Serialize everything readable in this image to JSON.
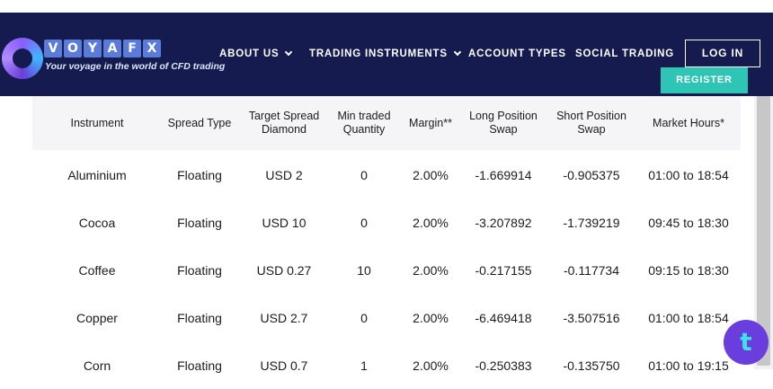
{
  "brand": {
    "logo_letters": [
      "V",
      "O",
      "Y",
      "A",
      "F",
      "X"
    ],
    "tagline": "Your voyage in the world of CFD trading"
  },
  "nav": {
    "items": [
      {
        "label": "ABOUT US",
        "has_dropdown": true
      },
      {
        "label": "TRADING INSTRUMENTS",
        "has_dropdown": true
      },
      {
        "label": "ACCOUNT TYPES",
        "has_dropdown": false
      },
      {
        "label": "SOCIAL TRADING",
        "has_dropdown": false
      }
    ],
    "login_label": "LOG IN",
    "register_label": "REGISTER"
  },
  "table": {
    "headers": [
      "Instrument",
      "Spread Type",
      "Target Spread\nDiamond",
      "Min traded\nQuantity",
      "Margin**",
      "Long Position\nSwap",
      "Short Position\nSwap",
      "Market Hours*"
    ],
    "rows": [
      [
        "Aluminium",
        "Floating",
        "USD 2",
        "0",
        "2.00%",
        "-1.669914",
        "-0.905375",
        "01:00 to 18:54"
      ],
      [
        "Cocoa",
        "Floating",
        "USD 10",
        "0",
        "2.00%",
        "-3.207892",
        "-1.739219",
        "09:45 to 18:30"
      ],
      [
        "Coffee",
        "Floating",
        "USD 0.27",
        "10",
        "2.00%",
        "-0.217155",
        "-0.117734",
        "09:15 to 18:30"
      ],
      [
        "Copper",
        "Floating",
        "USD 2.7",
        "0",
        "2.00%",
        "-6.469418",
        "-3.507516",
        "01:00 to 18:54"
      ],
      [
        "Corn",
        "Floating",
        "USD 0.7",
        "1",
        "2.00%",
        "-0.250383",
        "-0.135750",
        "01:00 to 19:15"
      ]
    ]
  },
  "chat_widget": {
    "icon": "chat-widget-icon",
    "glyph": "t"
  },
  "colors": {
    "navbar": "#151a4f",
    "register": "#2ec4b6",
    "chat_widget": "#6a3dde"
  }
}
